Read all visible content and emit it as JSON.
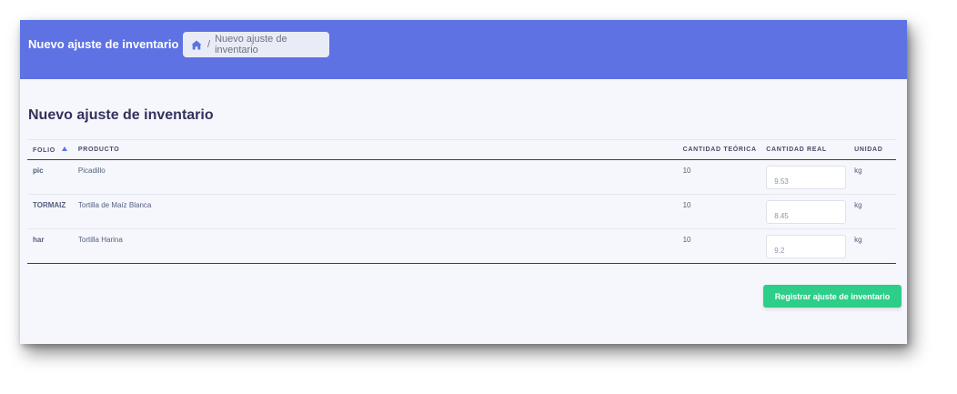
{
  "header": {
    "title": "Nuevo ajuste de inventario",
    "breadcrumb": {
      "home_icon": "home-icon",
      "separator": "/",
      "current": "Nuevo ajuste de inventario"
    }
  },
  "main": {
    "title": "Nuevo ajuste de inventario",
    "columns": {
      "folio": "FOLIO",
      "producto": "PRODUCTO",
      "cantidad_teorica": "CANTIDAD TEÓRICA",
      "cantidad_real": "CANTIDAD REAL",
      "unidad": "UNIDAD"
    },
    "sort": {
      "column": "folio",
      "direction": "asc"
    },
    "rows": [
      {
        "folio": "pic",
        "producto": "Picadillo",
        "cantidad_teorica": "10",
        "cantidad_real": "9.53",
        "unidad": "kg"
      },
      {
        "folio": "TORMAIZ",
        "producto": "Tortilla de Maíz Blanca",
        "cantidad_teorica": "10",
        "cantidad_real": "8.45",
        "unidad": "kg"
      },
      {
        "folio": "har",
        "producto": "Tortilla Harina",
        "cantidad_teorica": "10",
        "cantidad_real": "9.2",
        "unidad": "kg"
      }
    ],
    "submit_label": "Registrar ajuste de inventario"
  },
  "colors": {
    "primary": "#5e72e4",
    "success": "#2dce89",
    "background": "#f6f7fc"
  }
}
